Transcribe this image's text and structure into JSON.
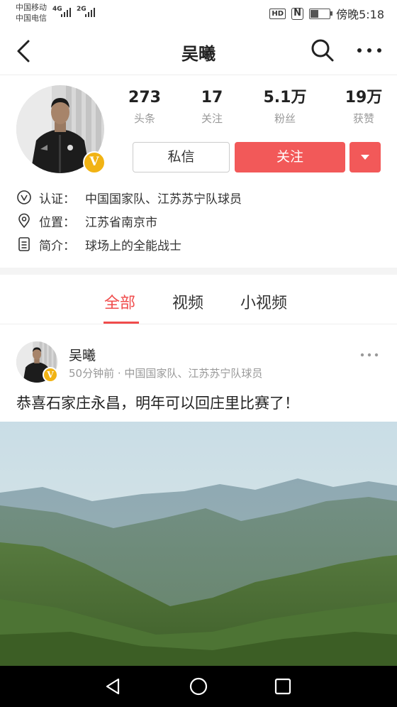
{
  "status_bar": {
    "carrier1": "中国移动",
    "carrier2": "中国电信",
    "network1": "4G",
    "network2": "2G",
    "time": "傍晚5:18",
    "battery_level": 0.4
  },
  "nav": {
    "title": "吴曦"
  },
  "profile": {
    "stats": [
      {
        "value": "273",
        "label": "头条"
      },
      {
        "value": "17",
        "label": "关注"
      },
      {
        "value": "5.1万",
        "label": "粉丝"
      },
      {
        "value": "19万",
        "label": "获赞"
      }
    ],
    "message_button": "私信",
    "follow_button": "关注",
    "info": [
      {
        "key": "认证：",
        "value": "中国国家队、江苏苏宁队球员",
        "icon": "verified-icon"
      },
      {
        "key": "位置：",
        "value": "江苏省南京市",
        "icon": "location-icon"
      },
      {
        "key": "简介：",
        "value": "球场上的全能战士",
        "icon": "document-icon"
      }
    ],
    "badge_letter": "V"
  },
  "tabs": [
    {
      "label": "全部",
      "active": true
    },
    {
      "label": "视频",
      "active": false
    },
    {
      "label": "小视频",
      "active": false
    }
  ],
  "post": {
    "author": "吴曦",
    "meta": "50分钟前 · 中国国家队、江苏苏宁队球员",
    "text": "恭喜石家庄永昌，明年可以回庄里比赛了！"
  },
  "colors": {
    "accent": "#f04c4c",
    "follow_bg": "#f25959",
    "badge": "#f1b314"
  }
}
